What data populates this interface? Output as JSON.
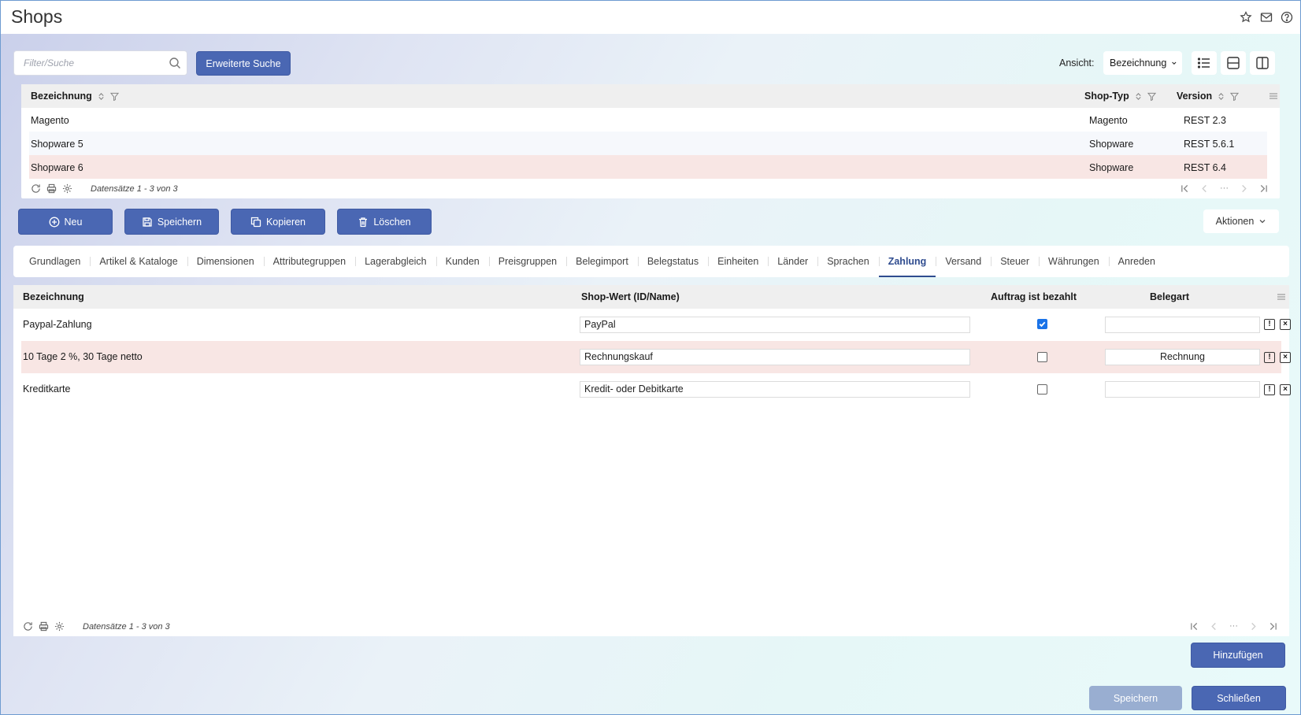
{
  "window": {
    "title": "Shops"
  },
  "search": {
    "placeholder": "Filter/Suche",
    "advanced_label": "Erweiterte Suche"
  },
  "view": {
    "label": "Ansicht:",
    "selected": "Bezeichnung"
  },
  "shops_grid": {
    "columns": [
      "Bezeichnung",
      "Shop-Typ",
      "Version"
    ],
    "rows": [
      {
        "name": "Magento",
        "type": "Magento",
        "version": "REST 2.3"
      },
      {
        "name": "Shopware 5",
        "type": "Shopware",
        "version": "REST 5.6.1"
      },
      {
        "name": "Shopware 6",
        "type": "Shopware",
        "version": "REST 6.4"
      }
    ],
    "footer": "Datensätze 1 - 3 von 3"
  },
  "actions": {
    "new_label": "Neu",
    "save_label": "Speichern",
    "copy_label": "Kopieren",
    "delete_label": "Löschen",
    "more_label": "Aktionen"
  },
  "tabs": [
    {
      "label": "Grundlagen"
    },
    {
      "label": "Artikel & Kataloge"
    },
    {
      "label": "Dimensionen"
    },
    {
      "label": "Attributegruppen"
    },
    {
      "label": "Lagerabgleich"
    },
    {
      "label": "Kunden"
    },
    {
      "label": "Preisgruppen"
    },
    {
      "label": "Belegimport"
    },
    {
      "label": "Belegstatus"
    },
    {
      "label": "Einheiten"
    },
    {
      "label": "Länder"
    },
    {
      "label": "Sprachen"
    },
    {
      "label": "Zahlung",
      "active": true
    },
    {
      "label": "Versand"
    },
    {
      "label": "Steuer"
    },
    {
      "label": "Währungen"
    },
    {
      "label": "Anreden"
    }
  ],
  "payment_grid": {
    "columns": [
      "Bezeichnung",
      "Shop-Wert (ID/Name)",
      "Auftrag ist bezahlt",
      "Belegart"
    ],
    "rows": [
      {
        "name": "Paypal-Zahlung",
        "shop_value": "PayPal",
        "paid": true,
        "doc_type": ""
      },
      {
        "name": "10 Tage 2 %, 30 Tage netto",
        "shop_value": "Rechnungskauf",
        "paid": false,
        "doc_type": "Rechnung"
      },
      {
        "name": "Kreditkarte",
        "shop_value": "Kredit- oder Debitkarte",
        "paid": false,
        "doc_type": ""
      }
    ],
    "footer": "Datensätze 1 - 3 von 3"
  },
  "bottom": {
    "add_label": "Hinzufügen",
    "save_label": "Speichern",
    "close_label": "Schließen"
  },
  "colors": {
    "primary": "#4a67b3",
    "selected_row": "#f8e6e4",
    "alt_row": "#f6f8fc",
    "active_tab": "#2f4c8f"
  }
}
